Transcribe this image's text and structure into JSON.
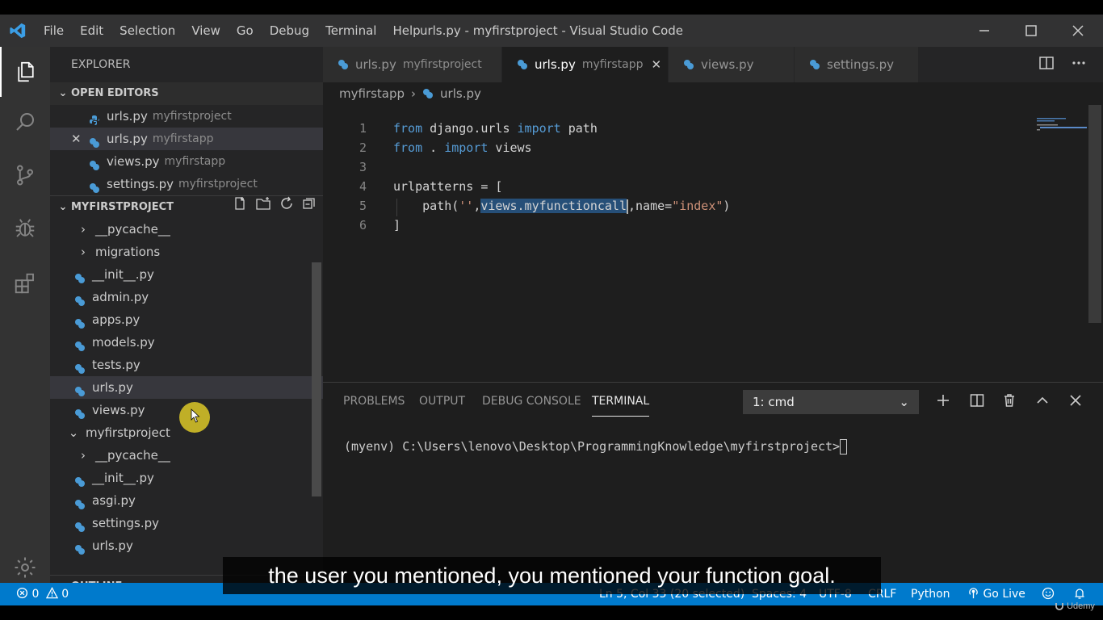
{
  "app": {
    "window_title": "urls.py - myfirstproject - Visual Studio Code",
    "menu": [
      "File",
      "Edit",
      "Selection",
      "View",
      "Go",
      "Debug",
      "Terminal",
      "Help"
    ]
  },
  "sidebar": {
    "title": "EXPLORER",
    "open_editors": {
      "header": "OPEN EDITORS",
      "items": [
        {
          "name": "urls.py",
          "desc": "myfirstproject"
        },
        {
          "name": "urls.py",
          "desc": "myfirstapp"
        },
        {
          "name": "views.py",
          "desc": "myfirstapp"
        },
        {
          "name": "settings.py",
          "desc": "myfirstproject"
        }
      ]
    },
    "project": {
      "header": "MYFIRSTPROJECT",
      "items": [
        {
          "name": "__pycache__"
        },
        {
          "name": "migrations"
        },
        {
          "name": "__init__.py"
        },
        {
          "name": "admin.py"
        },
        {
          "name": "apps.py"
        },
        {
          "name": "models.py"
        },
        {
          "name": "tests.py"
        },
        {
          "name": "urls.py"
        },
        {
          "name": "views.py"
        },
        {
          "name": "myfirstproject"
        },
        {
          "name": "__pycache__"
        },
        {
          "name": "__init__.py"
        },
        {
          "name": "asgi.py"
        },
        {
          "name": "settings.py"
        },
        {
          "name": "urls.py"
        }
      ]
    },
    "outline_header": "OUTLINE"
  },
  "tabs": [
    {
      "name": "urls.py",
      "desc": "myfirstproject"
    },
    {
      "name": "urls.py",
      "desc": "myfirstapp"
    },
    {
      "name": "views.py"
    },
    {
      "name": "settings.py"
    }
  ],
  "breadcrumb": {
    "folder": "myfirstapp",
    "file": "urls.py"
  },
  "editor": {
    "line_numbers": [
      "1",
      "2",
      "3",
      "4",
      "5",
      "6"
    ],
    "line1": {
      "kw1": "from",
      "mod": " django.urls ",
      "kw2": "import",
      "rest": " path"
    },
    "line2": {
      "kw1": "from",
      "mod": " . ",
      "kw2": "import",
      "rest": " views"
    },
    "line4": {
      "text": "urlpatterns = ["
    },
    "line5": {
      "pre": "    path(",
      "str1": "''",
      "comma": ",",
      "selected": "views.myfunctioncall",
      "mid": ",name=",
      "str2": "\"index\"",
      "post": ")"
    },
    "line6": {
      "text": "]"
    }
  },
  "panel": {
    "tabs": [
      "PROBLEMS",
      "OUTPUT",
      "DEBUG CONSOLE",
      "TERMINAL"
    ],
    "terminal_select": "1: cmd",
    "terminal_line": "(myenv) C:\\Users\\lenovo\\Desktop\\ProgrammingKnowledge\\myfirstproject>"
  },
  "statusbar": {
    "errors": "0",
    "warnings": "0",
    "position": "Ln 5, Col 33 (20 selected)",
    "spaces": "Spaces: 4",
    "encoding": "UTF-8",
    "eol": "CRLF",
    "language": "Python",
    "golive": "Go Live"
  },
  "subtitle": "the user you mentioned, you mentioned your function goal.",
  "watermark": "Udemy",
  "colors": {
    "accent": "#007acc",
    "keyword": "#569cd6",
    "string": "#ce9178",
    "python_icon": "#4a9bd6"
  }
}
